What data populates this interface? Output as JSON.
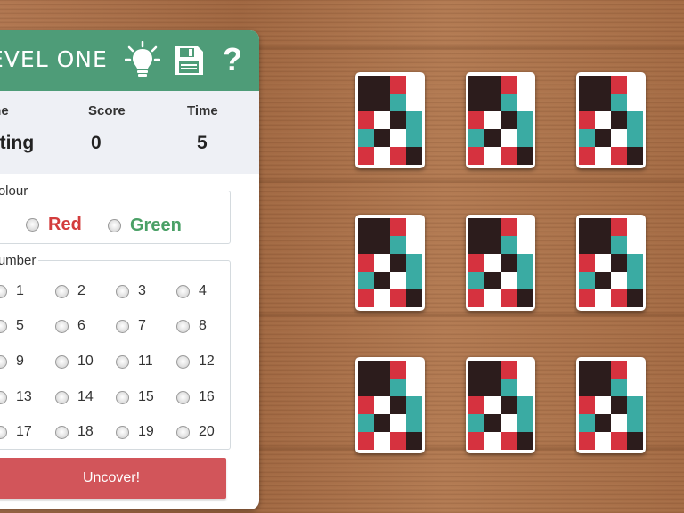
{
  "header": {
    "level_title": "EVEL ONE",
    "icons": [
      "lightbulb-icon",
      "floppy-disk-icon",
      "question-mark-icon"
    ],
    "help_glyph": "?"
  },
  "stats": {
    "name_label": "me",
    "name_value": "sting",
    "score_label": "Score",
    "score_value": "0",
    "time_label": "Time",
    "time_value": "5"
  },
  "colour": {
    "legend": "Colour",
    "options": [
      "Red",
      "Green"
    ],
    "colors": {
      "red": "#d33d3d",
      "green": "#4aa066"
    }
  },
  "number": {
    "legend": "Number",
    "options": [
      "1",
      "2",
      "3",
      "4",
      "5",
      "6",
      "7",
      "8",
      "9",
      "10",
      "11",
      "12",
      "13",
      "14",
      "15",
      "16",
      "17",
      "18",
      "19",
      "20"
    ]
  },
  "uncover_label": "Uncover!",
  "colors": {
    "header_green": "#4e9c78",
    "button_red": "#d2555a",
    "card_dark": "#2c1c1c",
    "card_red": "#d6323f",
    "card_teal": "#3aaba3"
  },
  "cards": {
    "count": 9
  }
}
